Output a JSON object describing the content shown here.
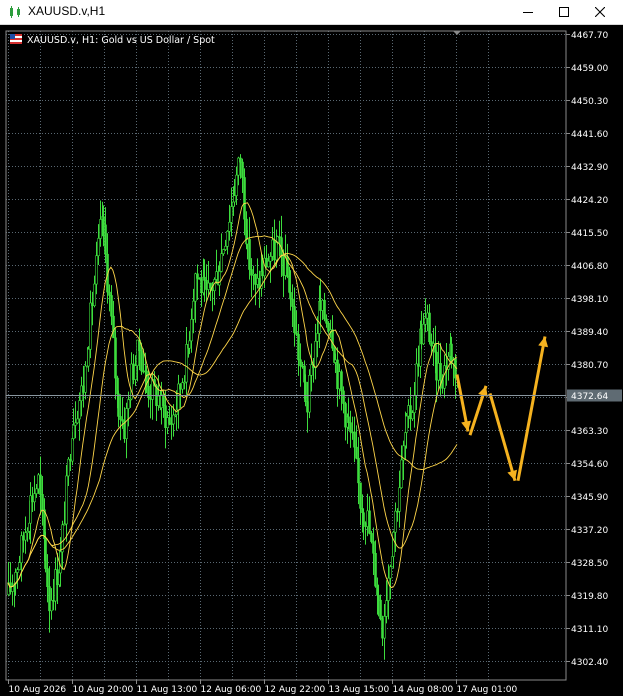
{
  "window": {
    "title": "XAUUSD.v,H1",
    "min_icon": "minimize-icon",
    "max_icon": "maximize-icon",
    "close_icon": "close-icon"
  },
  "chart_header": {
    "symbol_text": "XAUUSD.v, H1:  Gold vs US Dollar / Spot",
    "flag_icon": "flag-icon"
  },
  "colors": {
    "background": "#000000",
    "grid": "#5a6872",
    "bull_candle": "#3ddc3d",
    "bear_candle": "#3ddc3d",
    "ma": "#ffd64a",
    "arrow": "#f5b21f",
    "price_label_bg": "#5f6b73",
    "axis_text": "#ffffff"
  },
  "chart_data": {
    "type": "candlestick",
    "title": "XAUUSD.v, H1:  Gold vs US Dollar / Spot",
    "ylim": [
      4297.5,
      4468.5
    ],
    "y_ticks": [
      "4467.70",
      "4459.00",
      "4450.30",
      "4441.60",
      "4432.90",
      "4424.20",
      "4415.50",
      "4406.80",
      "4398.10",
      "4389.40",
      "4380.70",
      "4372.00",
      "4363.30",
      "4354.60",
      "4345.90",
      "4337.20",
      "4328.50",
      "4319.80",
      "4311.10",
      "4302.40"
    ],
    "x_ticks": [
      "10 Aug 2026",
      "10 Aug 20:00",
      "11 Aug 13:00",
      "12 Aug 06:00",
      "12 Aug 22:00",
      "13 Aug 15:00",
      "14 Aug 08:00",
      "17 Aug 01:00"
    ],
    "current_price": "4372.64",
    "grid": true
  }
}
